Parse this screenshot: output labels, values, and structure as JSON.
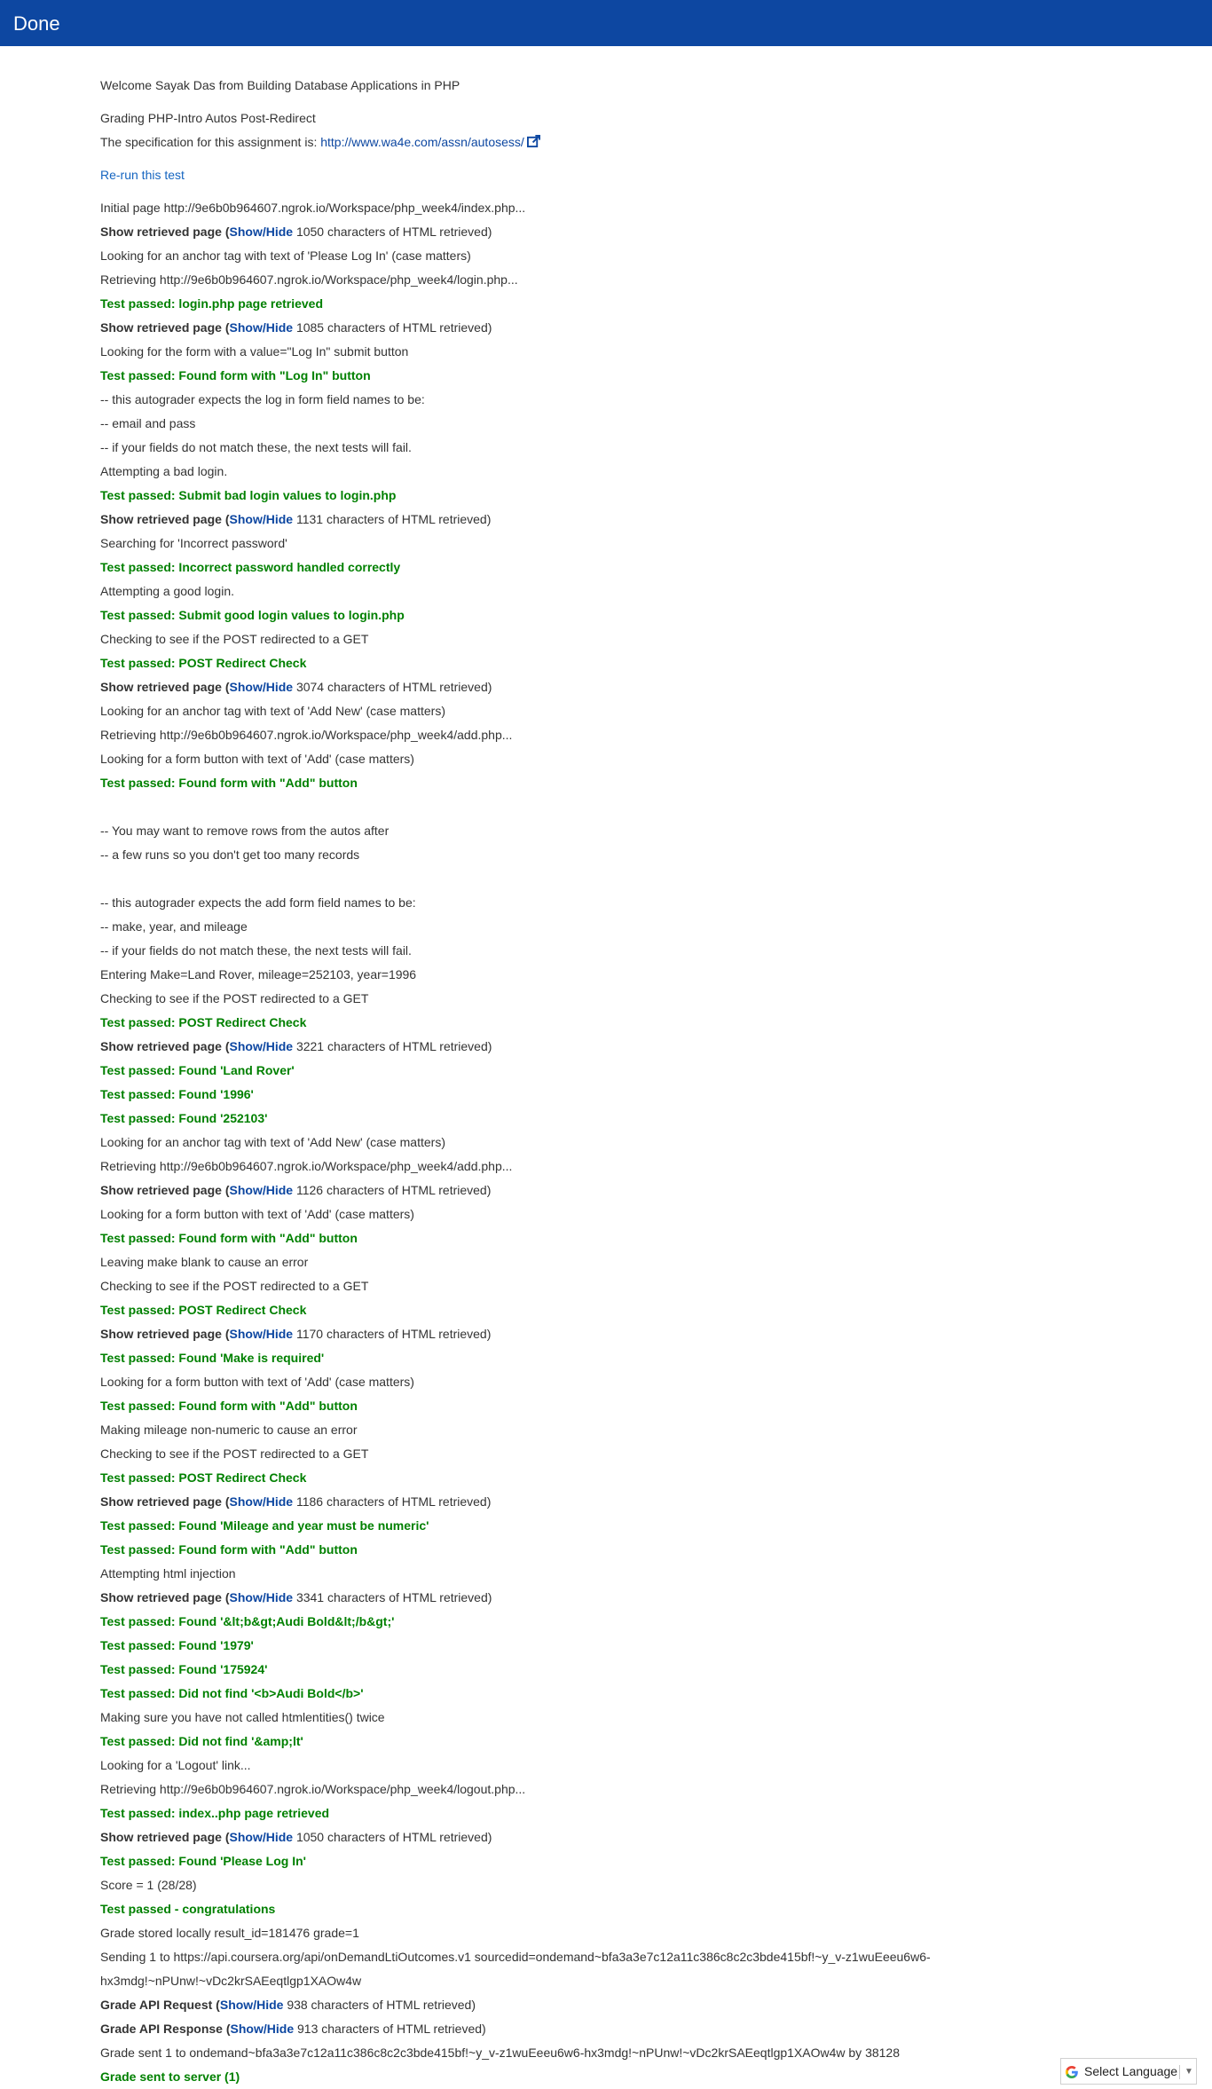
{
  "header": {
    "title": "Done"
  },
  "intro": {
    "welcome": "Welcome Sayak Das from Building Database Applications in PHP",
    "grading": "Grading PHP-Intro Autos Post-Redirect",
    "spec_prefix": "The specification for this assignment is: ",
    "spec_link": "http://www.wa4e.com/assn/autosess/",
    "rerun": "Re-run this test"
  },
  "log": [
    {
      "type": "text",
      "text": "Initial page http://9e6b0b964607.ngrok.io/Workspace/php_week4/index.php..."
    },
    {
      "type": "show",
      "label": "Show retrieved page",
      "link": "Show/Hide",
      "detail": "1050 characters of HTML retrieved)"
    },
    {
      "type": "text",
      "text": "Looking for an anchor tag with text of 'Please Log In' (case matters)"
    },
    {
      "type": "text",
      "text": "Retrieving http://9e6b0b964607.ngrok.io/Workspace/php_week4/login.php..."
    },
    {
      "type": "pass",
      "text": "Test passed: login.php page retrieved"
    },
    {
      "type": "show",
      "label": "Show retrieved page",
      "link": "Show/Hide",
      "detail": "1085 characters of HTML retrieved)"
    },
    {
      "type": "text",
      "text": "Looking for the form with a value=\"Log In\" submit button"
    },
    {
      "type": "pass",
      "text": "Test passed: Found form with \"Log In\" button"
    },
    {
      "type": "text",
      "text": "-- this autograder expects the log in form field names to be:"
    },
    {
      "type": "text",
      "text": "-- email and pass"
    },
    {
      "type": "text",
      "text": "-- if your fields do not match these, the next tests will fail."
    },
    {
      "type": "text",
      "text": "Attempting a bad login."
    },
    {
      "type": "pass",
      "text": "Test passed: Submit bad login values to login.php"
    },
    {
      "type": "show",
      "label": "Show retrieved page",
      "link": "Show/Hide",
      "detail": "1131 characters of HTML retrieved)"
    },
    {
      "type": "text",
      "text": "Searching for 'Incorrect password'"
    },
    {
      "type": "pass",
      "text": "Test passed: Incorrect password handled correctly"
    },
    {
      "type": "text",
      "text": "Attempting a good login."
    },
    {
      "type": "pass",
      "text": "Test passed: Submit good login values to login.php"
    },
    {
      "type": "text",
      "text": "Checking to see if the POST redirected to a GET"
    },
    {
      "type": "pass",
      "text": "Test passed: POST Redirect Check"
    },
    {
      "type": "show",
      "label": "Show retrieved page",
      "link": "Show/Hide",
      "detail": "3074 characters of HTML retrieved)"
    },
    {
      "type": "text",
      "text": "Looking for an anchor tag with text of 'Add New' (case matters)"
    },
    {
      "type": "text",
      "text": "Retrieving http://9e6b0b964607.ngrok.io/Workspace/php_week4/add.php..."
    },
    {
      "type": "text",
      "text": "Looking for a form button with text of 'Add' (case matters)"
    },
    {
      "type": "pass",
      "text": "Test passed: Found form with \"Add\" button"
    },
    {
      "type": "blank",
      "text": ""
    },
    {
      "type": "text",
      "text": "-- You may want to remove rows from the autos after"
    },
    {
      "type": "text",
      "text": "-- a few runs so you don't get too many records"
    },
    {
      "type": "blank",
      "text": ""
    },
    {
      "type": "text",
      "text": "-- this autograder expects the add form field names to be:"
    },
    {
      "type": "text",
      "text": "-- make, year, and mileage"
    },
    {
      "type": "text",
      "text": "-- if your fields do not match these, the next tests will fail."
    },
    {
      "type": "text",
      "text": "Entering Make=Land Rover, mileage=252103, year=1996"
    },
    {
      "type": "text",
      "text": "Checking to see if the POST redirected to a GET"
    },
    {
      "type": "pass",
      "text": "Test passed: POST Redirect Check"
    },
    {
      "type": "show",
      "label": "Show retrieved page",
      "link": "Show/Hide",
      "detail": "3221 characters of HTML retrieved)"
    },
    {
      "type": "pass",
      "text": "Test passed: Found 'Land Rover'"
    },
    {
      "type": "pass",
      "text": "Test passed: Found '1996'"
    },
    {
      "type": "pass",
      "text": "Test passed: Found '252103'"
    },
    {
      "type": "text",
      "text": "Looking for an anchor tag with text of 'Add New' (case matters)"
    },
    {
      "type": "text",
      "text": "Retrieving http://9e6b0b964607.ngrok.io/Workspace/php_week4/add.php..."
    },
    {
      "type": "show",
      "label": "Show retrieved page",
      "link": "Show/Hide",
      "detail": "1126 characters of HTML retrieved)"
    },
    {
      "type": "text",
      "text": "Looking for a form button with text of 'Add' (case matters)"
    },
    {
      "type": "pass",
      "text": "Test passed: Found form with \"Add\" button"
    },
    {
      "type": "text",
      "text": "Leaving make blank to cause an error"
    },
    {
      "type": "text",
      "text": "Checking to see if the POST redirected to a GET"
    },
    {
      "type": "pass",
      "text": "Test passed: POST Redirect Check"
    },
    {
      "type": "show",
      "label": "Show retrieved page",
      "link": "Show/Hide",
      "detail": "1170 characters of HTML retrieved)"
    },
    {
      "type": "pass",
      "text": "Test passed: Found 'Make is required'"
    },
    {
      "type": "text",
      "text": "Looking for a form button with text of 'Add' (case matters)"
    },
    {
      "type": "pass",
      "text": "Test passed: Found form with \"Add\" button"
    },
    {
      "type": "text",
      "text": "Making mileage non-numeric to cause an error"
    },
    {
      "type": "text",
      "text": "Checking to see if the POST redirected to a GET"
    },
    {
      "type": "pass",
      "text": "Test passed: POST Redirect Check"
    },
    {
      "type": "show",
      "label": "Show retrieved page",
      "link": "Show/Hide",
      "detail": "1186 characters of HTML retrieved)"
    },
    {
      "type": "pass",
      "text": "Test passed: Found 'Mileage and year must be numeric'"
    },
    {
      "type": "pass",
      "text": "Test passed: Found form with \"Add\" button"
    },
    {
      "type": "text",
      "text": "Attempting html injection"
    },
    {
      "type": "show",
      "label": "Show retrieved page",
      "link": "Show/Hide",
      "detail": "3341 characters of HTML retrieved)"
    },
    {
      "type": "pass",
      "text": "Test passed: Found '&lt;b&gt;Audi Bold&lt;/b&gt;'"
    },
    {
      "type": "pass",
      "text": "Test passed: Found '1979'"
    },
    {
      "type": "pass",
      "text": "Test passed: Found '175924'"
    },
    {
      "type": "pass",
      "text": "Test passed: Did not find '<b>Audi Bold</b>'"
    },
    {
      "type": "text",
      "text": "Making sure you have not called htmlentities() twice"
    },
    {
      "type": "pass",
      "text": "Test passed: Did not find '&amp;lt'"
    },
    {
      "type": "text",
      "text": "Looking for a 'Logout' link..."
    },
    {
      "type": "text",
      "text": "Retrieving http://9e6b0b964607.ngrok.io/Workspace/php_week4/logout.php..."
    },
    {
      "type": "pass",
      "text": "Test passed: index..php page retrieved"
    },
    {
      "type": "show",
      "label": "Show retrieved page",
      "link": "Show/Hide",
      "detail": "1050 characters of HTML retrieved)"
    },
    {
      "type": "pass",
      "text": "Test passed: Found 'Please Log In'"
    },
    {
      "type": "text",
      "text": "Score = 1 (28/28)"
    },
    {
      "type": "pass",
      "text": "Test passed - congratulations"
    },
    {
      "type": "text",
      "text": "Grade stored locally result_id=181476 grade=1"
    },
    {
      "type": "wrap",
      "text": "Sending 1 to https://api.coursera.org/api/onDemandLtiOutcomes.v1 sourcedid=ondemand~bfa3a3e7c12a11c386c8c2c3bde415bf!~y_v-z1wuEeeu6w6-hx3mdg!~nPUnw!~vDc2krSAEeqtlgp1XAOw4w"
    },
    {
      "type": "show",
      "label": "Grade API Request",
      "link": "Show/Hide",
      "detail": "938 characters of HTML retrieved)"
    },
    {
      "type": "show",
      "label": "Grade API Response",
      "link": "Show/Hide",
      "detail": "913 characters of HTML retrieved)"
    },
    {
      "type": "text",
      "text": "Grade sent 1 to ondemand~bfa3a3e7c12a11c386c8c2c3bde415bf!~y_v-z1wuEeeu6w6-hx3mdg!~nPUnw!~vDc2krSAEeqtlgp1XAOw4w by 38128"
    },
    {
      "type": "pass",
      "text": "Grade sent to server (1)"
    }
  ],
  "language_widget": {
    "label": "Select Language",
    "caret": "▼",
    "icon": "google-g-icon"
  },
  "colors": {
    "header_bg": "#0d47a1",
    "pass_green": "#008000",
    "link_blue": "#0d47a1"
  }
}
